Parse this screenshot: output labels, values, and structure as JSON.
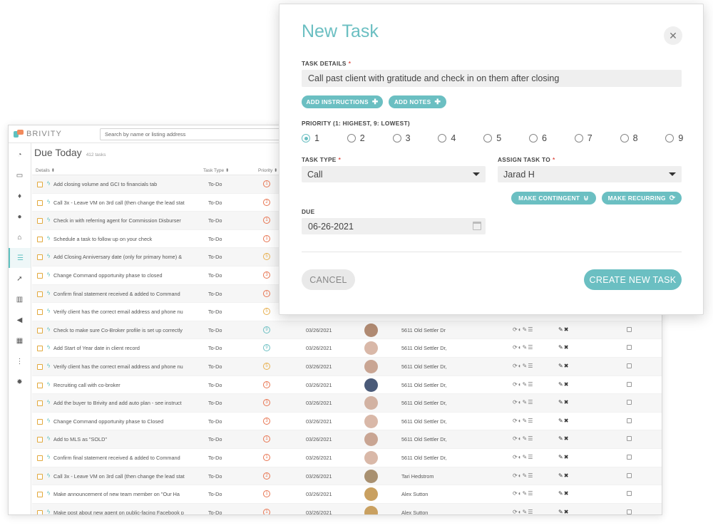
{
  "app": {
    "brand": "BRIVITY",
    "search_placeholder": "Search by name or listing address",
    "page_title": "Due Today",
    "task_count": "412 tasks",
    "columns": {
      "details": "Details ⬍",
      "task_type": "Task Type ⬍",
      "priority": "Priority ⬍"
    },
    "sidebar_icons": [
      "dashboard-icon",
      "inbox-icon",
      "drop-icon",
      "person-icon",
      "home-icon",
      "list-icon",
      "rocket-icon",
      "bar-chart-icon",
      "megaphone-icon",
      "calendar-icon",
      "grid-icon",
      "gear-icon"
    ],
    "rows": [
      {
        "desc": "Add closing volume and GCI to financials tab",
        "type": "To-Do",
        "prio": "1",
        "prio_color": "#e8734f",
        "date": "",
        "addr": ""
      },
      {
        "desc": "Call 3x - Leave VM on 3rd call (then change the lead stat",
        "type": "To-Do",
        "prio": "2",
        "prio_color": "#e8734f",
        "date": "",
        "addr": ""
      },
      {
        "desc": "Check in with referring agent for Commission Disburser",
        "type": "To-Do",
        "prio": "1",
        "prio_color": "#e8734f",
        "date": "",
        "addr": ""
      },
      {
        "desc": "Schedule a task to follow up on your check",
        "type": "To-Do",
        "prio": "1",
        "prio_color": "#e8734f",
        "date": "",
        "addr": ""
      },
      {
        "desc": "Add Closing Anniversary date (only for primary home) &",
        "type": "To-Do",
        "prio": "5",
        "prio_color": "#e8b04f",
        "date": "",
        "addr": ""
      },
      {
        "desc": "Change Command opportunity phase to closed",
        "type": "To-Do",
        "prio": "3",
        "prio_color": "#e8734f",
        "date": "",
        "addr": ""
      },
      {
        "desc": "Confirm final statement received & added to Command",
        "type": "To-Do",
        "prio": "1",
        "prio_color": "#e8734f",
        "date": "",
        "addr": ""
      },
      {
        "desc": "Verify client has the correct email address and phone nu",
        "type": "To-Do",
        "prio": "5",
        "prio_color": "#e8b04f",
        "date": "",
        "addr": ""
      },
      {
        "desc": "Check to make sure Co-Broker profile is set up correctly",
        "type": "To-Do",
        "prio": "9",
        "prio_color": "#6bbfc2",
        "date": "03/26/2021",
        "addr": "5611 Old Settler Dr"
      },
      {
        "desc": "Add Start of Year date in client record",
        "type": "To-Do",
        "prio": "9",
        "prio_color": "#6bbfc2",
        "date": "03/26/2021",
        "addr": "5611 Old Settler Dr,"
      },
      {
        "desc": "Verify client has the correct email address and phone nu",
        "type": "To-Do",
        "prio": "5",
        "prio_color": "#e8b04f",
        "date": "03/26/2021",
        "addr": "5611 Old Settler Dr,"
      },
      {
        "desc": "Recruiting call with co-broker",
        "type": "To-Do",
        "prio": "3",
        "prio_color": "#e8734f",
        "date": "03/26/2021",
        "addr": "5611 Old Settler Dr,"
      },
      {
        "desc": "Add the buyer to Brivity and add auto plan - see instruct",
        "type": "To-Do",
        "prio": "3",
        "prio_color": "#e8734f",
        "date": "03/26/2021",
        "addr": "5611 Old Settler Dr,"
      },
      {
        "desc": "Change Command opportunity phase to Closed",
        "type": "To-Do",
        "prio": "3",
        "prio_color": "#e8734f",
        "date": "03/26/2021",
        "addr": "5611 Old Settler Dr,"
      },
      {
        "desc": "Add to MLS as \"SOLD\"",
        "type": "To-Do",
        "prio": "1",
        "prio_color": "#e8734f",
        "date": "03/26/2021",
        "addr": "5611 Old Settler Dr,"
      },
      {
        "desc": "Confirm final statement received & added to Command",
        "type": "To-Do",
        "prio": "1",
        "prio_color": "#e8734f",
        "date": "03/26/2021",
        "addr": "5611 Old Settler Dr,"
      },
      {
        "desc": "Call 3x - Leave VM on 3rd call (then change the lead stat",
        "type": "To-Do",
        "prio": "2",
        "prio_color": "#e8734f",
        "date": "03/26/2021",
        "addr": "Tari Hedstrom"
      },
      {
        "desc": "Make announcement of new team member on \"Our Ha",
        "type": "To-Do",
        "prio": "1",
        "prio_color": "#e8734f",
        "date": "03/26/2021",
        "addr": "Alex Sutton"
      },
      {
        "desc": "Make post about new agent on public-facing Facebook p",
        "type": "To-Do",
        "prio": "1",
        "prio_color": "#e8734f",
        "date": "03/26/2021",
        "addr": "Alex Sutton"
      }
    ],
    "avatar_colors": [
      "#b08a72",
      "#d9b8a8",
      "#c9a593",
      "#4a5a78",
      "#d2b2a2",
      "#d9b8a8",
      "#c9a593",
      "#d9b8a8",
      "#a89070",
      "#c9a060",
      "#c9a060"
    ]
  },
  "modal": {
    "title": "New Task",
    "close_glyph": "✕",
    "task_details_label": "TASK DETAILS",
    "required_mark": "*",
    "task_details_value": "Call past client with gratitude and check in on them after closing",
    "add_instructions": "ADD INSTRUCTIONS",
    "add_notes": "ADD NOTES",
    "priority_label": "PRIORITY (1: HIGHEST, 9: LOWEST)",
    "priorities": [
      "1",
      "2",
      "3",
      "4",
      "5",
      "6",
      "7",
      "8",
      "9"
    ],
    "selected_priority": "1",
    "task_type_label": "TASK TYPE",
    "task_type_value": "Call",
    "assign_label": "ASSIGN TASK TO",
    "assign_value": "Jarad H",
    "make_contingent": "MAKE CONTINGENT",
    "make_recurring": "MAKE RECURRING",
    "due_label": "DUE",
    "due_value": "06-26-2021",
    "cancel": "CANCEL",
    "create": "CREATE NEW TASK",
    "accent_color": "#6bbfc2"
  }
}
